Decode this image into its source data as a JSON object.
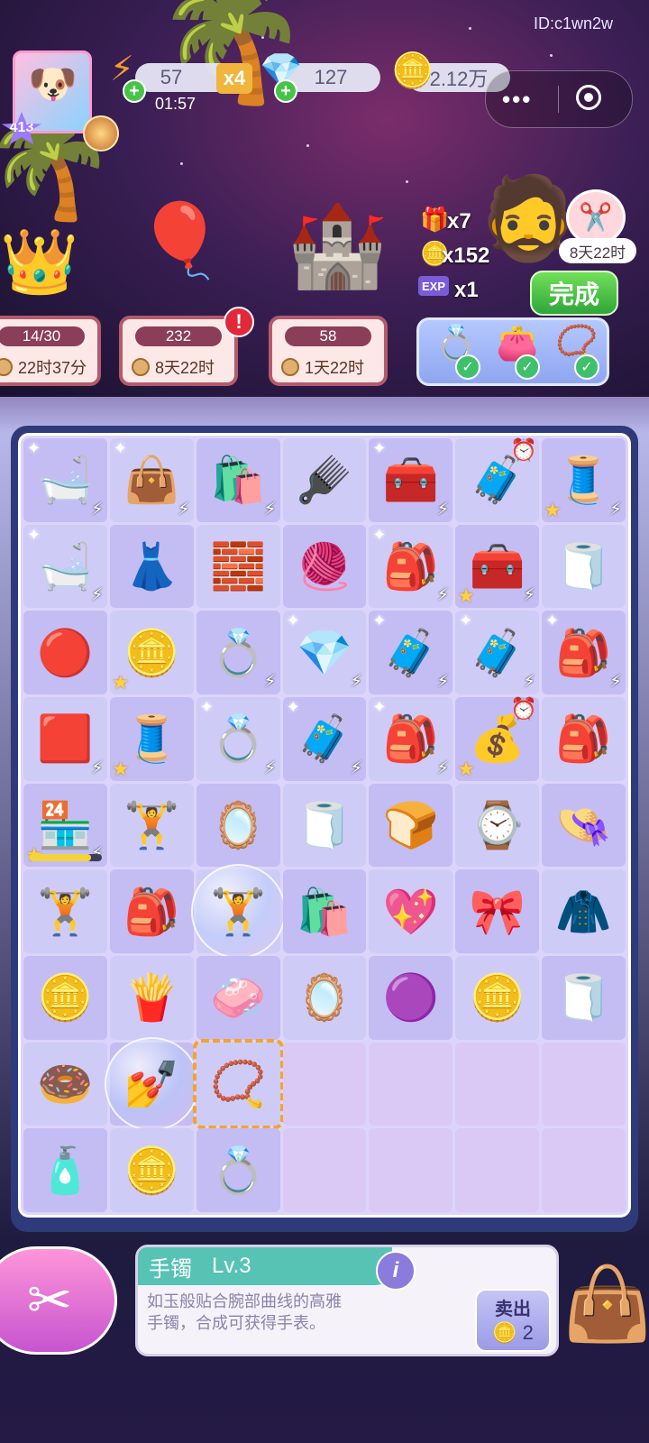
{
  "header": {
    "id_label": "ID:c1wn2w",
    "player_level": "413",
    "energy": "57",
    "energy_multiplier": "x4",
    "energy_timer": "01:57",
    "gems": "127",
    "coins": "2.12万",
    "menu_dots": "•••"
  },
  "buildings": [
    {
      "count": "14/30",
      "time": "22时37分"
    },
    {
      "count": "232",
      "time": "8天22时",
      "alert": "!"
    },
    {
      "count": "58",
      "time": "1天22时"
    }
  ],
  "customer": {
    "rewards": [
      {
        "icon": "gift-icon",
        "text": "x7"
      },
      {
        "icon": "coin-icon",
        "text": "x152"
      },
      {
        "icon": "exp-icon",
        "text": "x1"
      }
    ],
    "done_label": "完成",
    "next_order_time": "8天22时"
  },
  "board": {
    "cells": [
      {
        "glyph": "🛁",
        "name": "vanity-item",
        "spark": true,
        "bolt": true
      },
      {
        "glyph": "👜",
        "name": "tote-bag-item",
        "spark": true,
        "bolt": true
      },
      {
        "glyph": "🛍️",
        "name": "shopping-bag-item",
        "bolt": true
      },
      {
        "glyph": "🪮",
        "name": "hairbrush-item"
      },
      {
        "glyph": "🧰",
        "name": "jewelry-box-item",
        "spark": true,
        "bolt": true
      },
      {
        "glyph": "🧳",
        "name": "suitcase-generator-item",
        "clock": true
      },
      {
        "glyph": "🧵",
        "name": "sewing-machine-item",
        "star": true,
        "bolt": true
      },
      {
        "glyph": "🛁",
        "name": "vanity-item",
        "spark": true,
        "bolt": true
      },
      {
        "glyph": "👗",
        "name": "dress-item"
      },
      {
        "glyph": "🧱",
        "name": "fabric-block-item"
      },
      {
        "glyph": "🧶",
        "name": "thread-tray-item"
      },
      {
        "glyph": "🎒",
        "name": "purple-box-item",
        "spark": true,
        "bolt": true
      },
      {
        "glyph": "🧰",
        "name": "sewing-kit-item",
        "star": true,
        "bolt": true
      },
      {
        "glyph": "🧻",
        "name": "fabric-rolls-item"
      },
      {
        "glyph": "🔴",
        "name": "button-item"
      },
      {
        "glyph": "🪙",
        "name": "coin-stack-item",
        "star": true
      },
      {
        "glyph": "💍",
        "name": "ring-box-item",
        "bolt": true
      },
      {
        "glyph": "💎",
        "name": "jewelry-case-item",
        "spark": true,
        "bolt": true
      },
      {
        "glyph": "🧳",
        "name": "blue-bag-item",
        "spark": true,
        "bolt": true
      },
      {
        "glyph": "🧳",
        "name": "blue-bag-item",
        "spark": true,
        "bolt": true
      },
      {
        "glyph": "🎒",
        "name": "backpack-item",
        "spark": true,
        "bolt": true
      },
      {
        "glyph": "🟥",
        "name": "drawer-item",
        "bolt": true
      },
      {
        "glyph": "🧵",
        "name": "spool-tray-item",
        "star": true
      },
      {
        "glyph": "💍",
        "name": "ring-box-item",
        "spark": true,
        "bolt": true
      },
      {
        "glyph": "🧳",
        "name": "duffel-bag-item",
        "spark": true,
        "bolt": true
      },
      {
        "glyph": "🎒",
        "name": "blue-backpack-item",
        "spark": true,
        "bolt": true
      },
      {
        "glyph": "💰",
        "name": "money-sack-item",
        "star": true,
        "clock": true
      },
      {
        "glyph": "🎒",
        "name": "leather-backpack-item"
      },
      {
        "glyph": "🏪",
        "name": "vending-machine-item",
        "star": true,
        "bolt": true,
        "progress": 0.85
      },
      {
        "glyph": "🏋️",
        "name": "dumbbell-item"
      },
      {
        "glyph": "🪞",
        "name": "mirror-item"
      },
      {
        "glyph": "🧻",
        "name": "fabric-roll-item"
      },
      {
        "glyph": "🍞",
        "name": "bread-item"
      },
      {
        "glyph": "⌚",
        "name": "belt-item"
      },
      {
        "glyph": "👒",
        "name": "hat-item"
      },
      {
        "glyph": "🏋️",
        "name": "dumbbell-item"
      },
      {
        "glyph": "🎒",
        "name": "school-bag-item"
      },
      {
        "glyph": "🏋️",
        "name": "dumbbell-bubble-item",
        "bubble": true
      },
      {
        "glyph": "🛍️",
        "name": "paper-bag-item"
      },
      {
        "glyph": "💖",
        "name": "heart-mirror-item"
      },
      {
        "glyph": "🎀",
        "name": "bow-item"
      },
      {
        "glyph": "🧥",
        "name": "hoodie-item"
      },
      {
        "glyph": "🪙",
        "name": "coin-pile-item"
      },
      {
        "glyph": "🍟",
        "name": "chips-item"
      },
      {
        "glyph": "🧼",
        "name": "eraser-item"
      },
      {
        "glyph": "🪞",
        "name": "compact-mirror-item"
      },
      {
        "glyph": "🟣",
        "name": "powder-puff-item"
      },
      {
        "glyph": "🪙",
        "name": "coins-item"
      },
      {
        "glyph": "🧻",
        "name": "hair-rollers-item"
      },
      {
        "glyph": "🍩",
        "name": "donut-item"
      },
      {
        "glyph": "💅",
        "name": "nail-polish-bubble-item",
        "bubble": true
      },
      {
        "glyph": "📿",
        "name": "bracelet-item",
        "selected": true
      },
      {
        "empty": true
      },
      {
        "empty": true
      },
      {
        "empty": true
      },
      {
        "empty": true
      },
      {
        "glyph": "🧴",
        "name": "bottle-item"
      },
      {
        "glyph": "🪙",
        "name": "coin-item"
      },
      {
        "glyph": "💍",
        "name": "ring-item"
      },
      {
        "empty": true
      },
      {
        "empty": true
      },
      {
        "empty": true
      },
      {
        "empty": true
      }
    ]
  },
  "info": {
    "item_name": "手镯",
    "item_level": "Lv.3",
    "description": "如玉般贴合腕部曲线的高雅手镯，合成可获得手表。",
    "sell_label": "卖出",
    "sell_price": "2"
  }
}
